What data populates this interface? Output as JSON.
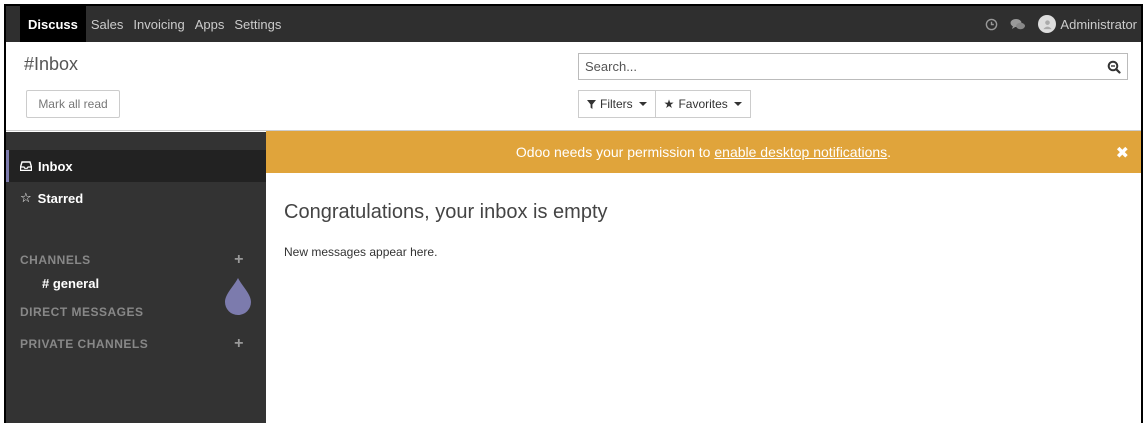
{
  "topbar": {
    "menu": [
      "Discuss",
      "Sales",
      "Invoicing",
      "Apps",
      "Settings"
    ],
    "active_menu": "Discuss",
    "user_name": "Administrator"
  },
  "control": {
    "title": "#Inbox",
    "mark_all_read": "Mark all read",
    "search_placeholder": "Search...",
    "filters_label": "Filters",
    "favorites_label": "Favorites"
  },
  "sidebar": {
    "inbox_label": "Inbox",
    "starred_label": "Starred",
    "channels_header": "CHANNELS",
    "channels": [
      "# general"
    ],
    "direct_messages_header": "DIRECT MESSAGES",
    "private_channels_header": "PRIVATE CHANNELS"
  },
  "notification": {
    "prefix": "Odoo needs your permission to ",
    "link": "enable desktop notifications",
    "suffix": "."
  },
  "main": {
    "empty_title": "Congratulations, your inbox is empty",
    "empty_subtitle": "New messages appear here."
  },
  "colors": {
    "topbar_bg": "#2f2f2f",
    "sidebar_bg": "#333333",
    "notify_bg": "#e0a43b",
    "accent": "#7c7bad"
  }
}
